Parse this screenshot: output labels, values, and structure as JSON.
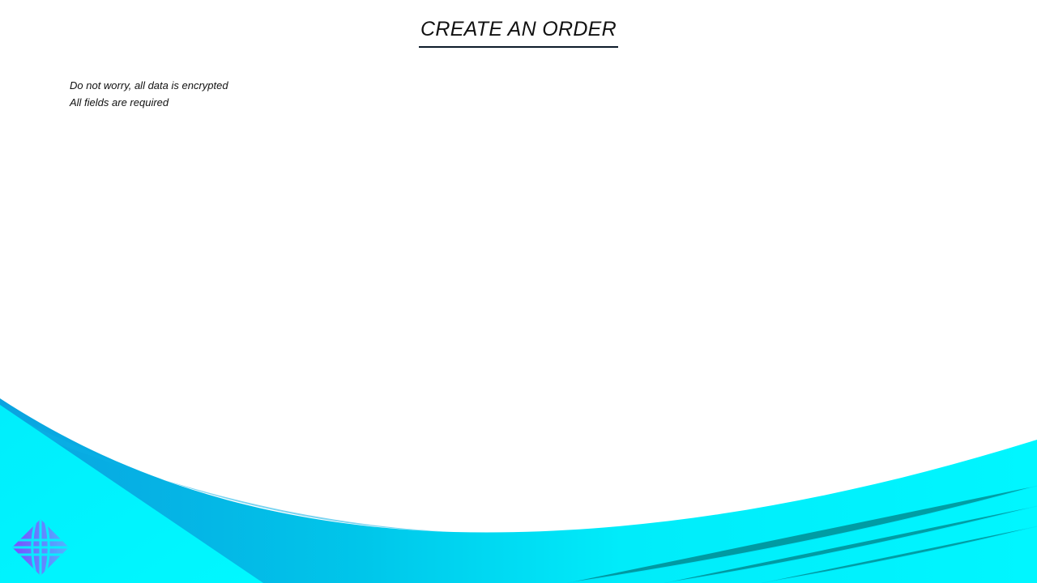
{
  "header": {
    "title": "CREATE AN ORDER"
  },
  "notes": {
    "line1": "Do not worry, all data is encrypted",
    "line2": "All fields are required"
  },
  "colors": {
    "wave_light": "#00f6ff",
    "wave_mid": "#00d8f0",
    "wave_dark": "#0aa3e0",
    "logo_start": "#7a4dff",
    "logo_end": "#4fb8ff",
    "underline": "#0d1b2a"
  },
  "icons": {
    "logo": "diamond-globe-icon"
  }
}
